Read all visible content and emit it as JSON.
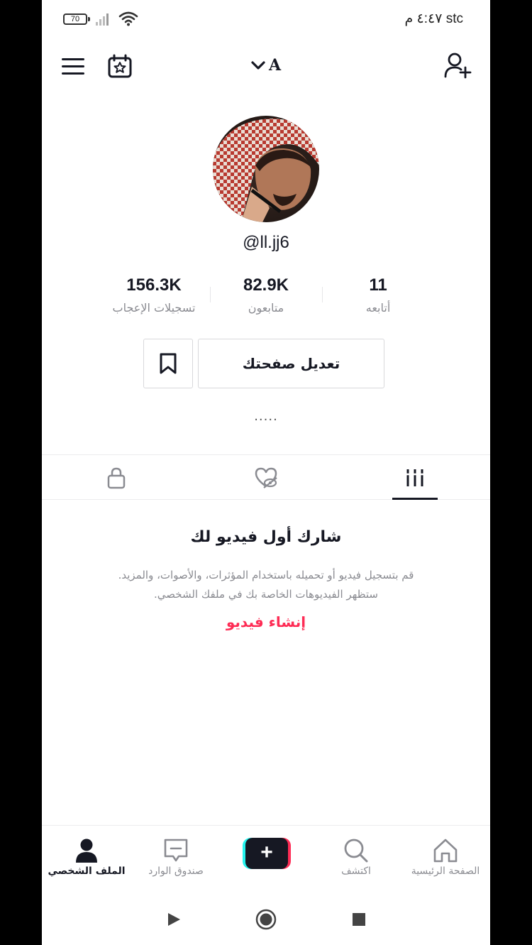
{
  "status_bar": {
    "battery": "70",
    "carrier_time": "stc ٤:٤٧ م"
  },
  "header": {
    "account_letter": "A",
    "icons": [
      "menu-icon",
      "calendar-star-icon",
      "chevron-down-icon",
      "add-user-icon"
    ]
  },
  "profile": {
    "username": "@ll.jj6",
    "stats": [
      {
        "value": "156.3K",
        "label": "تسجيلات الإعجاب"
      },
      {
        "value": "82.9K",
        "label": "متابعون"
      },
      {
        "value": "11",
        "label": "أتابعه"
      }
    ],
    "edit_label": "تعديل صفحتك",
    "bio": "....."
  },
  "tabs": [
    {
      "icon": "lock-icon"
    },
    {
      "icon": "liked-hidden-icon"
    },
    {
      "icon": "grid-videos-icon",
      "active": true
    }
  ],
  "empty_state": {
    "title": "شارك أول فيديو لك",
    "line1": "قم بتسجيل فيديو أو تحميله باستخدام المؤثرات، والأصوات، والمزيد.",
    "line2": "ستظهر الفيديوهات الخاصة بك في ملفك الشخصي.",
    "cta": "إنشاء فيديو"
  },
  "bottom_nav": {
    "profile": "الملف الشخصي",
    "inbox": "صندوق الوارد",
    "create": "+",
    "discover": "اكتشف",
    "home": "الصفحة الرئيسية"
  },
  "colors": {
    "accent": "#fe2c55",
    "cyan": "#25f4ee",
    "text": "#161823",
    "muted": "#8a8b91"
  }
}
